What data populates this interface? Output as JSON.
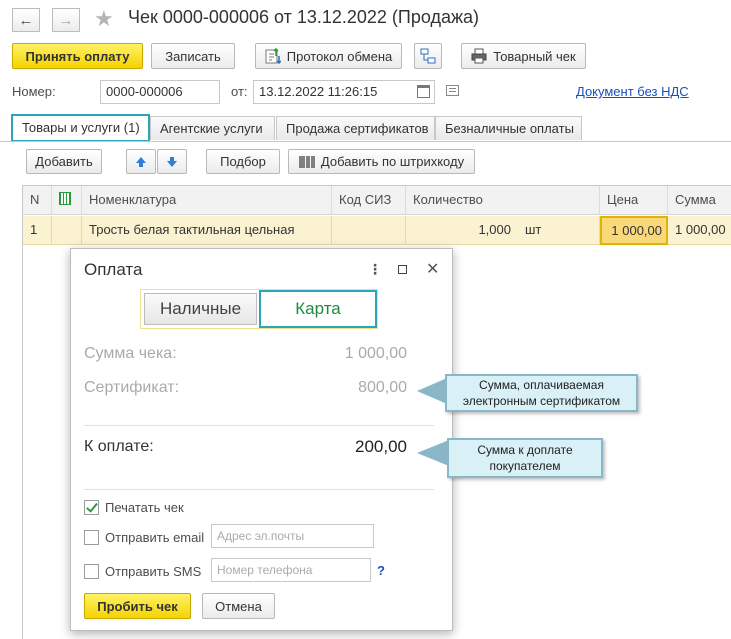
{
  "window": {
    "title": "Чек 0000-000006 от 13.12.2022 (Продажа)"
  },
  "toolbar": {
    "accept_payment": "Принять оплату",
    "save": "Записать",
    "exchange_log": "Протокол обмена",
    "sales_receipt": "Товарный чек"
  },
  "header": {
    "number_label": "Номер:",
    "number_value": "0000-000006",
    "date_label": "от:",
    "date_value": "13.12.2022 11:26:15",
    "vat_link": "Документ без НДС"
  },
  "tabs": [
    {
      "label": "Товары и услуги (1)",
      "active": true
    },
    {
      "label": "Агентские услуги",
      "active": false
    },
    {
      "label": "Продажа сертификатов",
      "active": false
    },
    {
      "label": "Безналичные оплаты",
      "active": false
    }
  ],
  "table_toolbar": {
    "add": "Добавить",
    "select": "Подбор",
    "add_by_barcode": "Добавить по штрихкоду"
  },
  "table": {
    "columns": [
      "N",
      "",
      "Номенклатура",
      "Код СИЗ",
      "Количество",
      "Цена",
      "Сумма"
    ],
    "rows": [
      {
        "n": "1",
        "item": "Трость белая тактильная цельная",
        "siz_code": "",
        "quantity": "1,000",
        "unit": "шт",
        "price": "1 000,00",
        "sum": "1 000,00"
      }
    ]
  },
  "dialog": {
    "title": "Оплата",
    "payment_types": {
      "cash": "Наличные",
      "card": "Карта"
    },
    "receipt_sum_label": "Сумма чека:",
    "receipt_sum_value": "1 000,00",
    "certificate_label": "Сертификат:",
    "certificate_value": "800,00",
    "to_pay_label": "К оплате:",
    "to_pay_value": "200,00",
    "print_receipt": "Печатать чек",
    "print_receipt_checked": true,
    "send_email": "Отправить email",
    "send_email_checked": false,
    "email_placeholder": "Адрес эл.почты",
    "send_sms": "Отправить SMS",
    "send_sms_checked": false,
    "phone_placeholder": "Номер телефона",
    "help": "?",
    "punch_button": "Пробить чек",
    "cancel_button": "Отмена"
  },
  "callouts": {
    "certificate_note": "Сумма, оплачиваемая электронным сертификатом",
    "to_pay_note": "Сумма к доплате покупателем"
  },
  "colors": {
    "accent_yellow": "#f5d300",
    "focus_teal": "#2aa5bb",
    "link_blue": "#1b4fbd",
    "row_highlight": "#fbf2d1",
    "card_green": "#1c8b3e",
    "callout_bg": "#d9f0f7"
  }
}
